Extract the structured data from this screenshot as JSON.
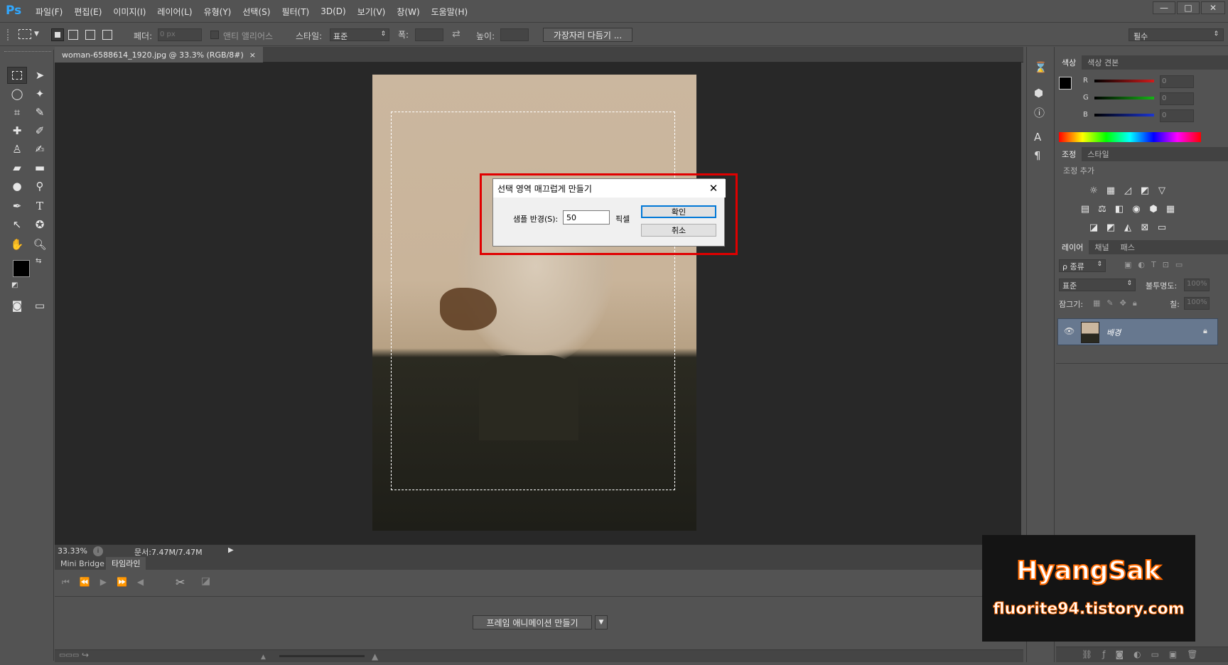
{
  "app": {
    "logo": "Ps"
  },
  "menu": [
    "파일(F)",
    "편집(E)",
    "이미지(I)",
    "레이어(L)",
    "유형(Y)",
    "선택(S)",
    "필터(T)",
    "3D(D)",
    "보기(V)",
    "창(W)",
    "도움말(H)"
  ],
  "window_controls": {
    "minimize": "—",
    "restore": "□",
    "close": "✕"
  },
  "options": {
    "feather_label": "페더:",
    "feather_value": "0 px",
    "antialias_label": "앤티 앨리어스",
    "style_label": "스타일:",
    "style_value": "표준",
    "width_label": "폭:",
    "height_label": "높이:",
    "refine_edge": "가장자리 다듬기 ...",
    "workspace": "필수"
  },
  "document": {
    "tab_title": "woman-6588614_1920.jpg @ 33.3% (RGB/8#)",
    "tab_close": "×",
    "zoom": "33.33%",
    "doc_info": "문서:7.47M/7.47M"
  },
  "timeline": {
    "tabs": [
      "Mini Bridge",
      "타임라인"
    ],
    "create_button": "프레임 애니메이션 만들기"
  },
  "panels": {
    "color_tabs": [
      "색상",
      "색상 견본"
    ],
    "channels": [
      {
        "label": "R",
        "value": "0",
        "color": "#d21b1b"
      },
      {
        "label": "G",
        "value": "0",
        "color": "#15b515"
      },
      {
        "label": "B",
        "value": "0",
        "color": "#1b35d2"
      }
    ],
    "adjust_tabs": [
      "조정",
      "스타일"
    ],
    "adjust_title": "조정 추가",
    "layer_tabs": [
      "레이어",
      "채널",
      "패스"
    ],
    "kind_filter": "ρ 종류",
    "blend_mode": "표준",
    "opacity_label": "불투명도:",
    "opacity_value": "100%",
    "lock_label": "잠그기:",
    "fill_label": "칠:",
    "fill_value": "100%",
    "layer_name": "배경"
  },
  "dialog": {
    "title": "선택 영역 매끄럽게 만들기",
    "sample_label": "샘플 반경(S):",
    "sample_value": "50",
    "unit": "픽셀",
    "ok": "확인",
    "cancel": "취소"
  },
  "watermark": {
    "name": "HyangSak",
    "url": "fluorite94.tistory.com"
  }
}
